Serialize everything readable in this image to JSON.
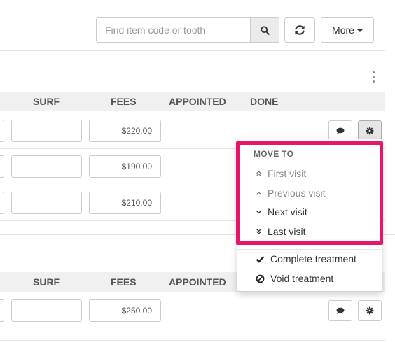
{
  "toolbar": {
    "search_placeholder": "Find item code or tooth",
    "more_label": "More"
  },
  "icons": {
    "search": "search-icon",
    "refresh": "refresh-icon",
    "kebab": "vertical-dots-icon",
    "comment": "comment-icon",
    "gear": "gear-icon"
  },
  "table1": {
    "columns": [
      "SURF",
      "FEES",
      "APPOINTED",
      "DONE"
    ],
    "rows": [
      {
        "fee": "$220.00"
      },
      {
        "fee": "$190.00"
      },
      {
        "fee": "$210.00"
      }
    ]
  },
  "table2": {
    "columns": [
      "SURF",
      "FEES",
      "APPOINTED"
    ],
    "rows": [
      {
        "fee": "$250.00"
      }
    ]
  },
  "menu": {
    "header": "MOVE TO",
    "items": [
      {
        "label": "First visit",
        "icon": "double-chevron-up-icon",
        "disabled": true
      },
      {
        "label": "Previous visit",
        "icon": "chevron-up-icon",
        "disabled": true
      },
      {
        "label": "Next visit",
        "icon": "chevron-down-icon",
        "disabled": false
      },
      {
        "label": "Last visit",
        "icon": "double-chevron-down-icon",
        "disabled": false
      }
    ],
    "actions": [
      {
        "label": "Complete treatment",
        "icon": "check-icon"
      },
      {
        "label": "Void treatment",
        "icon": "ban-icon"
      }
    ]
  },
  "colors": {
    "highlight": "#e8156a",
    "header_bg": "#f0f0f0"
  }
}
